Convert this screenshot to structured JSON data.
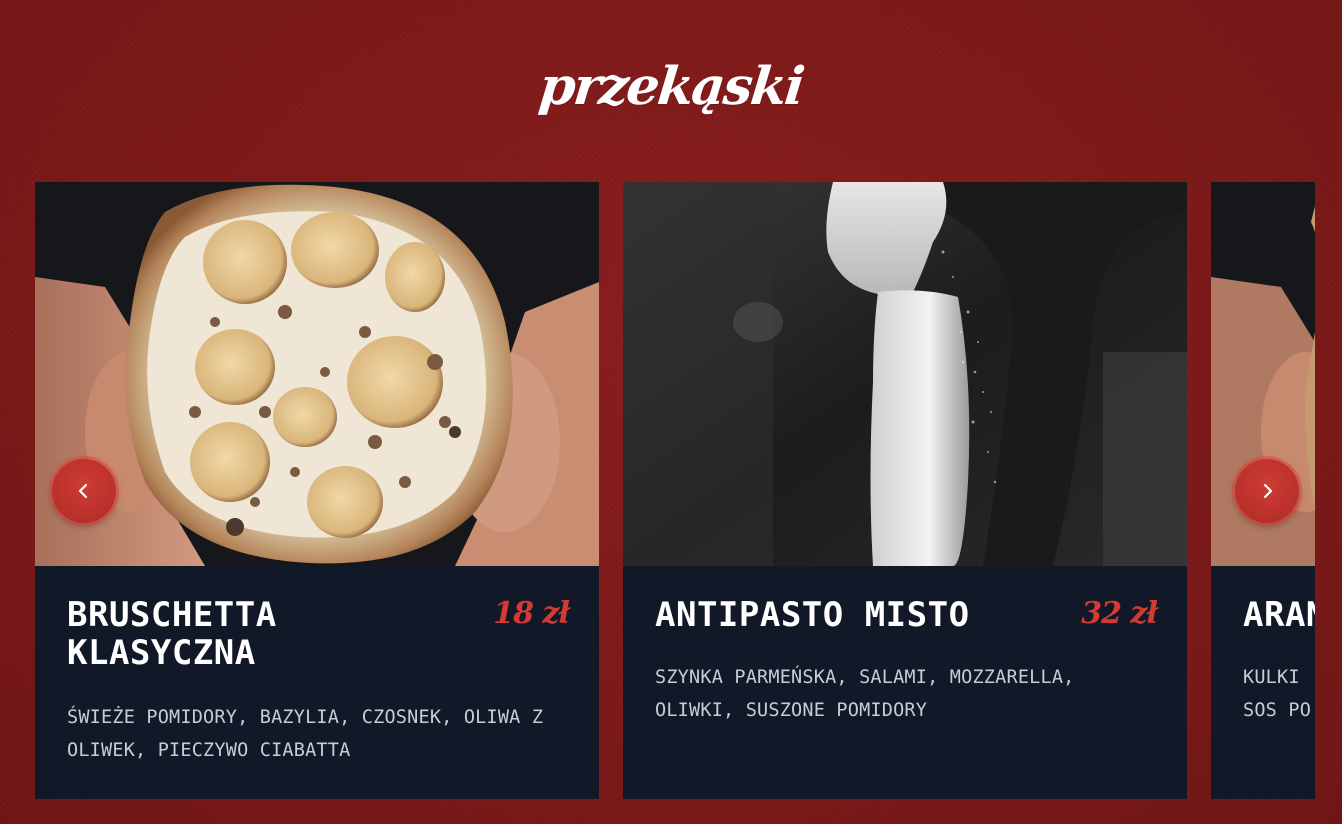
{
  "section": {
    "title": "przekąski"
  },
  "colors": {
    "background": "#7e1a1a",
    "card_background": "#111827",
    "accent": "#d13b32",
    "text_light": "#ffffff",
    "text_muted": "#c9ccd4"
  },
  "cards": [
    {
      "name": "BRUSCHETTA KLASYCZNA",
      "price": "18 zł",
      "description": "ŚWIEŻE POMIDORY, BAZYLIA, CZOSNEK, OLIWA Z OLIWEK, PIECZYWO CIABATTA",
      "image": "pizza-held-in-hands-photo"
    },
    {
      "name": "ANTIPASTO MISTO",
      "price": "32 zł",
      "description": "SZYNKA PARMEŃSKA, SALAMI, MOZZARELLA, OLIWKI, SUSZONE POMIDORY",
      "image": "flour-dusting-dough-photo"
    },
    {
      "name": "ARAN",
      "price": "",
      "description_line1": "KULKI",
      "description_line2": "SOS PO",
      "image": "pizza-held-in-hands-photo"
    }
  ],
  "nav": {
    "prev_icon": "chevron-left-icon",
    "next_icon": "chevron-right-icon"
  }
}
